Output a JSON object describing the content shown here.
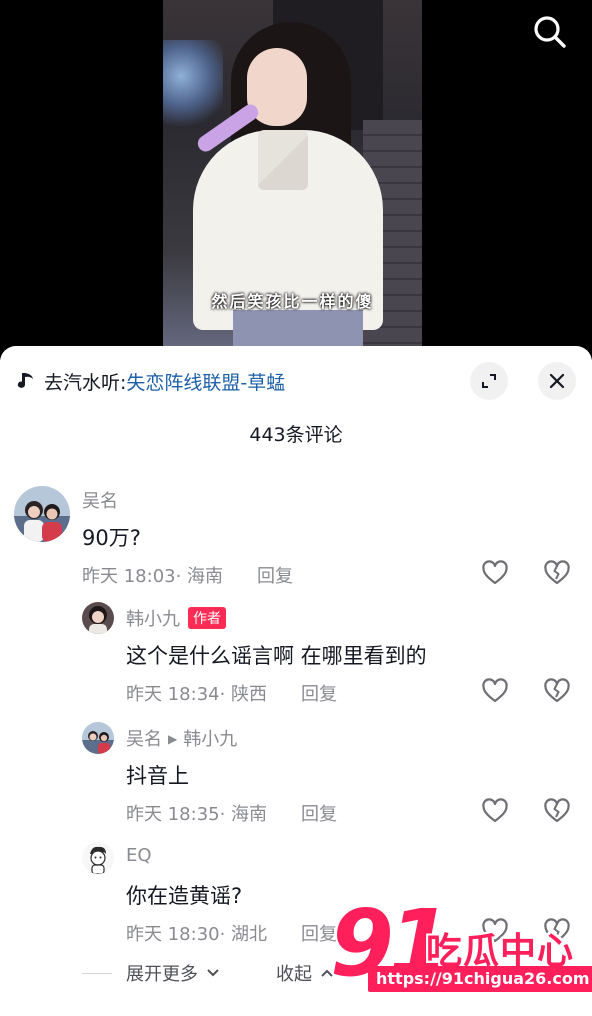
{
  "video": {
    "subtitle": "然后笑孩比一样的傻"
  },
  "icons": {
    "search": "search-icon",
    "music": "music-note-icon",
    "expand": "expand-icon",
    "close": "close-icon",
    "like": "heart-icon",
    "dislike": "broken-heart-icon"
  },
  "sheet": {
    "music_prefix": "去汽水听:",
    "music_song": "失恋阵线联盟-草蜢",
    "comment_count": "443条评论"
  },
  "comments": [
    {
      "name": "吴名",
      "text": "90万?",
      "meta": "昨天 18:03· 海南",
      "reply": "回复"
    },
    {
      "name": "韩小九",
      "badge": "作者",
      "text": "这个是什么谣言啊 在哪里看到的",
      "meta": "昨天 18:34· 陕西",
      "reply": "回复"
    },
    {
      "name": "吴名",
      "reply_to": "韩小九",
      "text": "抖音上",
      "meta": "昨天 18:35· 海南",
      "reply": "回复"
    },
    {
      "name": "EQ",
      "text": "你在造黄谣?",
      "meta": "昨天 18:30· 湖北",
      "reply": "回复"
    }
  ],
  "footer": {
    "expand_more": "展开更多",
    "collapse": "收起"
  },
  "watermark": {
    "number": "91",
    "name": "吃瓜中心",
    "url": "https://91chigua26.com"
  },
  "colors": {
    "accent": "#fe2c55",
    "song_link": "#1d5fa8",
    "secondary_text": "#8a8b91"
  }
}
